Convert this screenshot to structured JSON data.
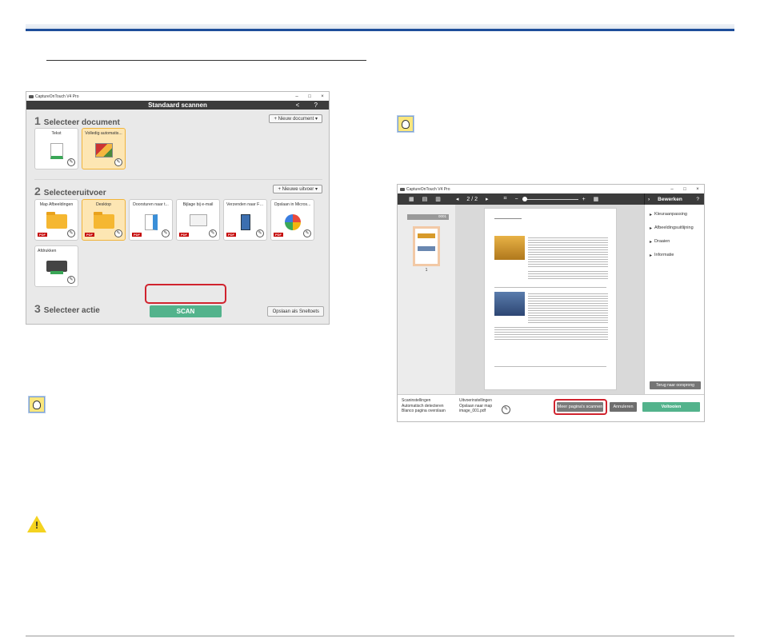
{
  "left_window": {
    "title": "CaptureOnTouch V4 Pro",
    "header_title": "Standaard scannen",
    "header_nav": "< ?",
    "step1": {
      "num": "1",
      "label": "Selecteer document",
      "button": "+ Nieuw document ▾"
    },
    "documents": [
      {
        "label": "Tekst",
        "selected": false
      },
      {
        "label": "Volledig automatis...",
        "selected": true
      }
    ],
    "step2": {
      "num": "2",
      "label": "Selecteeruitvoer",
      "button": "+ Nieuwe uitvoer ▾"
    },
    "outputs": [
      {
        "label": "Map Afbeeldingen",
        "icon": "folder-icon",
        "pdf": "PDF"
      },
      {
        "label": "Desktop",
        "icon": "folder-icon",
        "pdf": "PDF",
        "selected": true
      },
      {
        "label": "Doorsturen naar t...",
        "icon": "forward-document-icon",
        "pdf": "PDF"
      },
      {
        "label": "Bijlage bij e-mail",
        "icon": "mail-icon",
        "pdf": "PDF"
      },
      {
        "label": "Verzenden naar FT...",
        "icon": "ftp-icon",
        "pdf": "PDF"
      },
      {
        "label": "Opslaan in Micros...",
        "icon": "cloud-pie-icon",
        "pdf": "PDF"
      },
      {
        "label": "Afdrukken",
        "icon": "printer-icon"
      }
    ],
    "step3": {
      "num": "3",
      "label": "Selecteer actie"
    },
    "scan_label": "SCAN",
    "save_shortcut": "Opslaan als Sneltoets"
  },
  "right_window": {
    "title": "CaptureOnTouch V4 Pro",
    "page_indicator": "2 / 2",
    "panel_title": "Bewerken",
    "panel_help": "?",
    "thumb_counter": "0001",
    "thumb_number": "1",
    "side_items": [
      "Kleuraanpassing",
      "Afbeeldingsuitlijning",
      "Draaien",
      "Informatie"
    ],
    "restore_label": "Terug naar oorsprong",
    "scan_settings": {
      "header": "Scaninstellingen",
      "lines": [
        "Automatisch detecteren",
        "Blanco pagina overslaan"
      ]
    },
    "output_settings": {
      "header": "Uitvoerinstellingen",
      "lines": [
        "Opslaan naar map",
        "image_001.pdf"
      ]
    },
    "more_pages_label": "Meer pagina's scannen",
    "cancel_label": "Annuleren",
    "finish_label": "Voltooien"
  }
}
